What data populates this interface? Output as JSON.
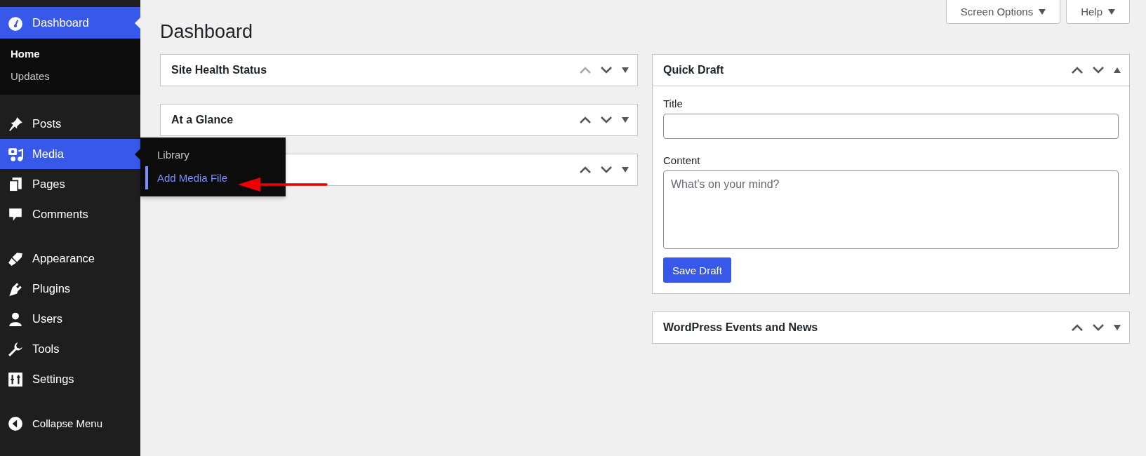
{
  "sidebar": {
    "menu_groups": [
      [
        {
          "label": "Dashboard",
          "kind": "gauge",
          "selected": true,
          "submenu": [
            {
              "label": "Home",
              "selected": true
            },
            {
              "label": "Updates",
              "selected": false
            }
          ]
        }
      ],
      [
        {
          "label": "Posts",
          "kind": "pin",
          "selected": false
        },
        {
          "label": "Media",
          "kind": "media",
          "selected": true,
          "flyout": [
            {
              "label": "Library",
              "selected": false
            },
            {
              "label": "Add Media File",
              "selected": true
            }
          ]
        },
        {
          "label": "Pages",
          "kind": "pages",
          "selected": false
        },
        {
          "label": "Comments",
          "kind": "comment",
          "selected": false
        }
      ],
      [
        {
          "label": "Appearance",
          "kind": "brush",
          "selected": false
        },
        {
          "label": "Plugins",
          "kind": "plug",
          "selected": false
        },
        {
          "label": "Users",
          "kind": "user",
          "selected": false
        },
        {
          "label": "Tools",
          "kind": "wrench",
          "selected": false
        },
        {
          "label": "Settings",
          "kind": "sliders",
          "selected": false
        }
      ]
    ],
    "collapse": {
      "label": "Collapse Menu"
    }
  },
  "header": {
    "title": "Dashboard",
    "buttons": [
      {
        "label": "Screen Options"
      },
      {
        "label": "Help"
      }
    ]
  },
  "left_column": [
    {
      "title": "Site Health Status",
      "move_up_disabled": true,
      "expanded": false
    },
    {
      "title": "At a Glance",
      "move_up_disabled": false,
      "expanded": false
    },
    {
      "move_up_disabled": false,
      "expanded": false
    }
  ],
  "right_column": [
    {
      "title": "Quick Draft",
      "move_up_disabled": false,
      "expanded": true,
      "form": {
        "title_label": "Title",
        "content_label": "Content",
        "content_placeholder": "What’s on your mind?",
        "button": "Save Draft"
      }
    },
    {
      "title": "WordPress Events and News",
      "move_up_disabled": false,
      "expanded": false
    }
  ]
}
